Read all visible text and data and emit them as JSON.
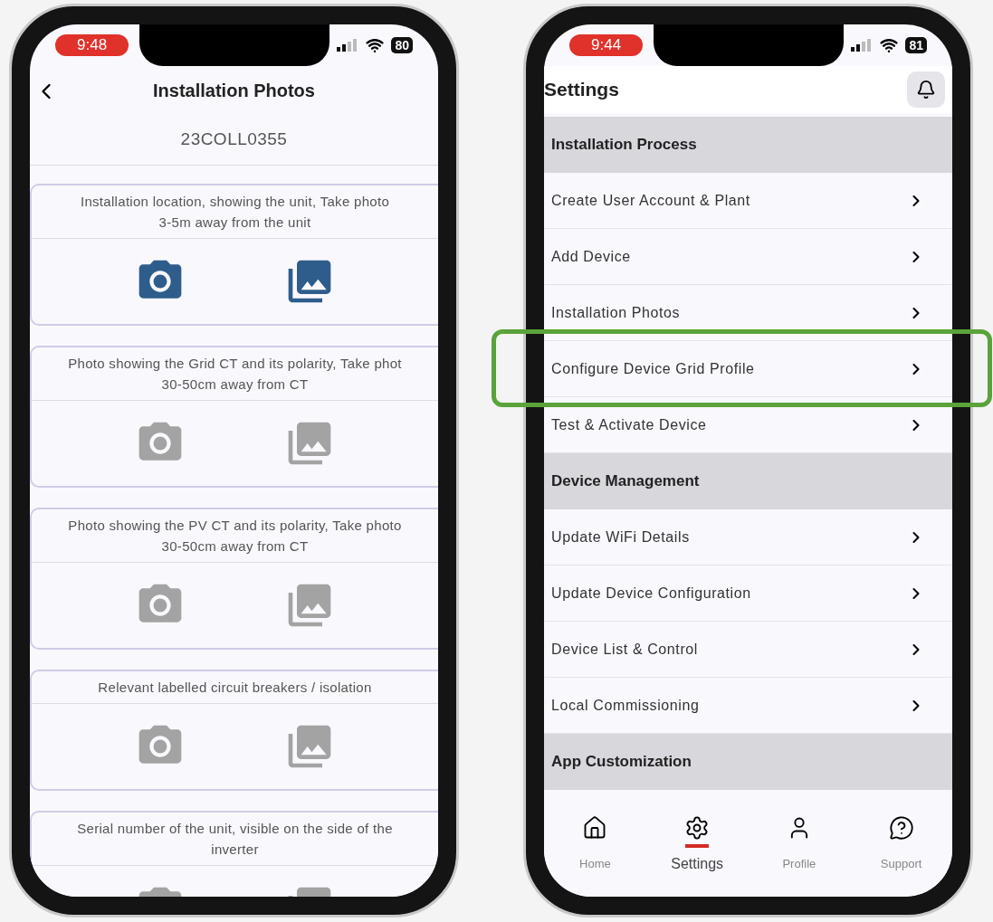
{
  "left_screen": {
    "status_bar": {
      "time": "9:48",
      "battery": "80"
    },
    "header": {
      "title": "Installation Photos"
    },
    "serial": "23COLL0355",
    "photo_items": [
      {
        "lines": [
          "Installation location, showing the unit, Take photo",
          "3-5m away from the unit"
        ],
        "active": true
      },
      {
        "lines": [
          "Photo showing the Grid CT and its polarity, Take phot",
          "30-50cm away from CT"
        ],
        "active": false
      },
      {
        "lines": [
          "Photo showing the PV CT and its polarity, Take photo",
          "30-50cm away from CT"
        ],
        "active": false
      },
      {
        "lines": [
          "Relevant labelled circuit breakers / isolation"
        ],
        "active": false
      },
      {
        "lines": [
          "Serial number of the unit, visible on the side of the",
          "inverter"
        ],
        "active": false
      }
    ]
  },
  "right_screen": {
    "status_bar": {
      "time": "9:44",
      "battery": "81"
    },
    "header": {
      "title": "Settings"
    },
    "sections": [
      {
        "title": "Installation Process",
        "items": [
          {
            "label": "Create User Account & Plant",
            "highlighted": false
          },
          {
            "label": "Add Device",
            "highlighted": false
          },
          {
            "label": "Installation Photos",
            "highlighted": false
          },
          {
            "label": "Configure Device Grid Profile",
            "highlighted": true
          },
          {
            "label": "Test & Activate Device",
            "highlighted": false
          }
        ]
      },
      {
        "title": "Device Management",
        "items": [
          {
            "label": "Update WiFi Details",
            "highlighted": false
          },
          {
            "label": "Update Device Configuration",
            "highlighted": false
          },
          {
            "label": "Device List & Control",
            "highlighted": false
          },
          {
            "label": "Local Commissioning",
            "highlighted": false
          }
        ]
      },
      {
        "title": "App Customization"
      }
    ],
    "tab_bar": [
      {
        "label": "Home",
        "kind": "home",
        "selected": false
      },
      {
        "label": "Settings",
        "kind": "settings",
        "selected": true
      },
      {
        "label": "Profile",
        "kind": "profile",
        "selected": false
      },
      {
        "label": "Support",
        "kind": "support",
        "selected": false
      }
    ]
  }
}
